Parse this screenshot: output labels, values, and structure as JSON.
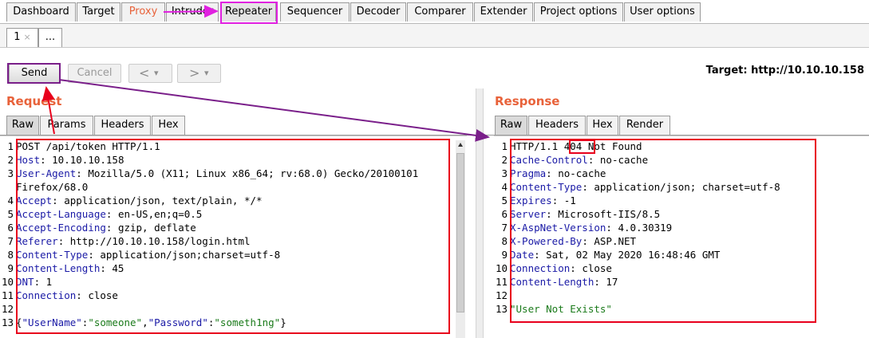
{
  "main_tabs": [
    {
      "label": "Dashboard"
    },
    {
      "label": "Target"
    },
    {
      "label": "Proxy"
    },
    {
      "label": "Intruder"
    },
    {
      "label": "Repeater"
    },
    {
      "label": "Sequencer"
    },
    {
      "label": "Decoder"
    },
    {
      "label": "Comparer"
    },
    {
      "label": "Extender"
    },
    {
      "label": "Project options"
    },
    {
      "label": "User options"
    }
  ],
  "sub_tabs": {
    "first": "1",
    "first_close": "×",
    "more": "..."
  },
  "toolbar": {
    "send": "Send",
    "cancel": "Cancel",
    "back": "<",
    "forward": ">",
    "dropdown": "▾",
    "target": "Target: http://10.10.10.158"
  },
  "request": {
    "title": "Request",
    "tabs": [
      "Raw",
      "Params",
      "Headers",
      "Hex"
    ],
    "lines": [
      {
        "n": "1",
        "key": "",
        "val": "POST /api/token HTTP/1.1"
      },
      {
        "n": "2",
        "key": "Host",
        "val": ": 10.10.10.158"
      },
      {
        "n": "3",
        "key": "User-Agent",
        "val": ": Mozilla/5.0 (X11; Linux x86_64; rv:68.0) Gecko/20100101"
      },
      {
        "n": "",
        "key": "",
        "val": "Firefox/68.0"
      },
      {
        "n": "4",
        "key": "Accept",
        "val": ": application/json, text/plain, */*"
      },
      {
        "n": "5",
        "key": "Accept-Language",
        "val": ": en-US,en;q=0.5"
      },
      {
        "n": "6",
        "key": "Accept-Encoding",
        "val": ": gzip, deflate"
      },
      {
        "n": "7",
        "key": "Referer",
        "val": ": http://10.10.10.158/login.html"
      },
      {
        "n": "8",
        "key": "Content-Type",
        "val": ": application/json;charset=utf-8"
      },
      {
        "n": "9",
        "key": "Content-Length",
        "val": ": 45"
      },
      {
        "n": "10",
        "key": "DNT",
        "val": ": 1"
      },
      {
        "n": "11",
        "key": "Connection",
        "val": ": close"
      },
      {
        "n": "12",
        "key": "",
        "val": ""
      }
    ],
    "body": {
      "n": "13",
      "open": "{",
      "k1": "\"UserName\"",
      "c1": ":",
      "v1": "\"someone\"",
      "sep": ",",
      "k2": "\"Password\"",
      "c2": ":",
      "v2": "\"someth1ng\"",
      "close": "}"
    }
  },
  "response": {
    "title": "Response",
    "tabs": [
      "Raw",
      "Headers",
      "Hex",
      "Render"
    ],
    "status": {
      "n": "1",
      "proto": "HTTP/1.1 ",
      "code": "404",
      "text": " Not Found"
    },
    "lines": [
      {
        "n": "2",
        "key": "Cache-Control",
        "val": ": no-cache"
      },
      {
        "n": "3",
        "key": "Pragma",
        "val": ": no-cache"
      },
      {
        "n": "4",
        "key": "Content-Type",
        "val": ": application/json; charset=utf-8"
      },
      {
        "n": "5",
        "key": "Expires",
        "val": ": -1"
      },
      {
        "n": "6",
        "key": "Server",
        "val": ": Microsoft-IIS/8.5"
      },
      {
        "n": "7",
        "key": "X-AspNet-Version",
        "val": ": 4.0.30319"
      },
      {
        "n": "8",
        "key": "X-Powered-By",
        "val": ": ASP.NET"
      },
      {
        "n": "9",
        "key": "Date",
        "val": ": Sat, 02 May 2020 16:48:46 GMT"
      },
      {
        "n": "10",
        "key": "Connection",
        "val": ": close"
      },
      {
        "n": "11",
        "key": "Content-Length",
        "val": ": 17"
      },
      {
        "n": "12",
        "key": "",
        "val": ""
      }
    ],
    "body": {
      "n": "13",
      "text": "\"User Not Exists\""
    }
  },
  "colors": {
    "accent": "#e8623a",
    "header_key": "#1a1aa6",
    "string": "#1a7a1a",
    "annotation_red": "#e8001c",
    "annotation_purple": "#7a1f8a",
    "annotation_magenta": "#e020e0"
  }
}
